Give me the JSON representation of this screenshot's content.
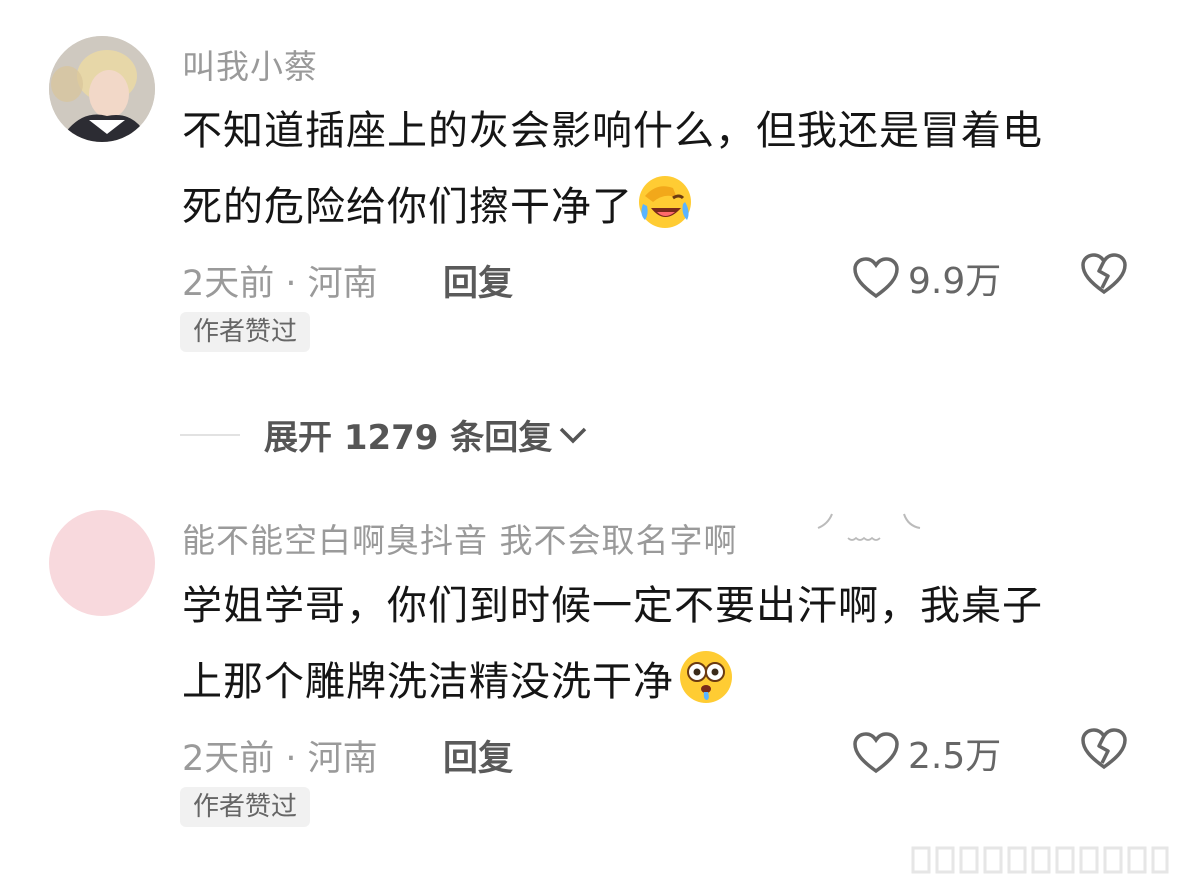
{
  "comments": [
    {
      "username": "叫我小蔡",
      "text_line1": "不知道插座上的灰会影响什么，但我还是冒着电",
      "text_line2": "死的危险给你们擦干净了",
      "meta": "2天前 · 河南",
      "reply_label": "回复",
      "likes": "9.9万",
      "badge": "作者赞过",
      "emoji": "laughing-crying-emoji"
    },
    {
      "username": "能不能空白啊臭抖音 我不会取名字啊",
      "text_line1": "学姐学哥，你们到时候一定不要出汗啊，我桌子",
      "text_line2": "上那个雕牌洗洁精没洗干净",
      "meta": "2天前 · 河南",
      "reply_label": "回复",
      "likes": "2.5万",
      "badge": "作者赞过",
      "emoji": "flushed-drooling-emoji"
    }
  ],
  "expand_replies": "展开 1279 条回复",
  "icons": {
    "like": "heart-outline-icon",
    "dislike": "broken-heart-icon",
    "expand": "chevron-down-icon"
  },
  "colors": {
    "muted_text": "#9a9a9a",
    "badge_bg": "#f1f1f1"
  }
}
